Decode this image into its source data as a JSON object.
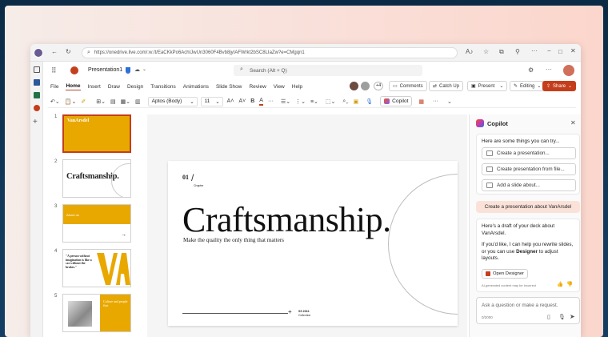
{
  "browser": {
    "url": "https://onedrive.live.com/:w:/t/EaCKkPo6AchIJwUn3060F4Bvb8jyIAFWrkt2bSC8LIaZw?e=CMgqn1"
  },
  "app": {
    "doc_title": "Presentation1",
    "search_placeholder": "Search (Alt + Q)",
    "presence_count": "+4",
    "comments_label": "Comments",
    "catchup_label": "Catch Up",
    "present_label": "Present",
    "editing_label": "Editing",
    "share_label": "Share"
  },
  "menu": [
    "File",
    "Home",
    "Insert",
    "Draw",
    "Design",
    "Transitions",
    "Animations",
    "Slide Show",
    "Review",
    "View",
    "Help"
  ],
  "ribbon": {
    "font_name": "Aptos (Body)",
    "font_size": "11",
    "copilot_label": "Copilot"
  },
  "thumbnails": [
    {
      "num": "1",
      "title": "VanArsdel"
    },
    {
      "num": "2",
      "title": "Craftsmanship."
    },
    {
      "num": "3",
      "title": "About us"
    },
    {
      "num": "4",
      "title": "\"A person without imagination is like a car without the brakes.\""
    },
    {
      "num": "5",
      "title": "Culture and people first"
    }
  ],
  "slide": {
    "number": "01",
    "chapter": "Chapter",
    "title": "Craftsmanship.",
    "subtitle": "Make the quality the only thing that matters",
    "footer_title": "SS 2024",
    "footer_sub": "Collection"
  },
  "copilot": {
    "title": "Copilot",
    "intro": "Here are some things you can try...",
    "suggestions": [
      "Create a presentation...",
      "Create presentation from file...",
      "Add a slide about..."
    ],
    "user_message": "Create a presentation about VanArsdel",
    "reply_1": "Here's a draft of your deck about VanArsdel.",
    "reply_2a": "If you'd like, I can help you rewrite slides, or you can use ",
    "reply_2b": "Designer",
    "reply_2c": " to adjust layouts.",
    "open_designer": "Open Designer",
    "disclaimer": "AI-generated content may be incorrect",
    "input_placeholder": "Ask a question or make a request.",
    "char_count": "0/2000"
  },
  "colors": {
    "accent": "#b7472a",
    "gold": "#e8a800",
    "brand_red": "#c43e1c"
  }
}
